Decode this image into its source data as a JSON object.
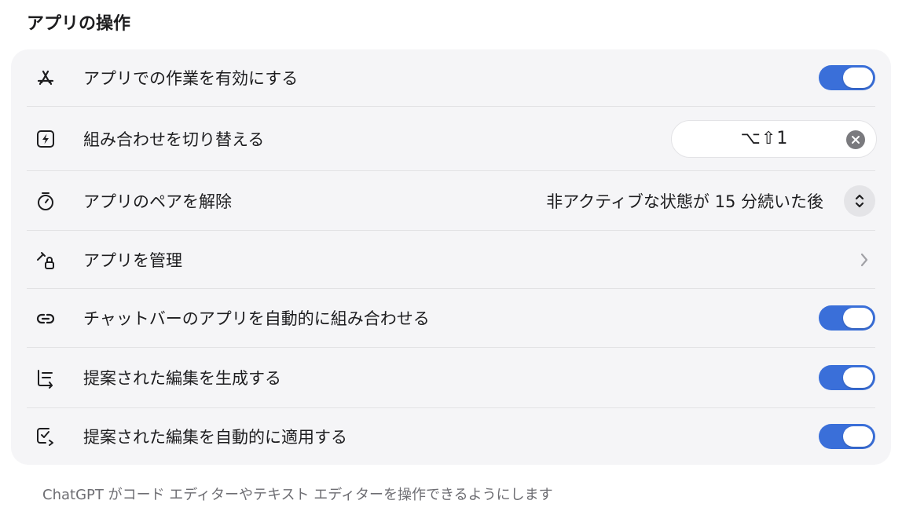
{
  "section": {
    "title": "アプリの操作"
  },
  "rows": [
    {
      "label": "アプリでの作業を有効にする",
      "control": "toggle",
      "state": true,
      "icon": "app-store-icon"
    },
    {
      "label": "組み合わせを切り替える",
      "control": "shortcut",
      "value": "⌥⇧1",
      "icon": "bolt-square-icon"
    },
    {
      "label": "アプリのペアを解除",
      "control": "select",
      "value": "非アクティブな状態が 15 分続いた後",
      "icon": "timer-icon"
    },
    {
      "label": "アプリを管理",
      "control": "chevron",
      "icon": "wrench-lock-icon"
    },
    {
      "label": "チャットバーのアプリを自動的に組み合わせる",
      "control": "toggle",
      "state": true,
      "icon": "link-icon"
    },
    {
      "label": "提案された編集を生成する",
      "control": "toggle",
      "state": true,
      "icon": "list-arrow-icon"
    },
    {
      "label": "提案された編集を自動的に適用する",
      "control": "toggle",
      "state": true,
      "icon": "checkbox-arrow-icon"
    }
  ],
  "footer": {
    "text": "ChatGPT がコード エディターやテキスト エディターを操作できるようにします"
  },
  "colors": {
    "accent": "#3a6fd9",
    "panel": "#f5f5f7",
    "muted": "#6e6e73"
  }
}
